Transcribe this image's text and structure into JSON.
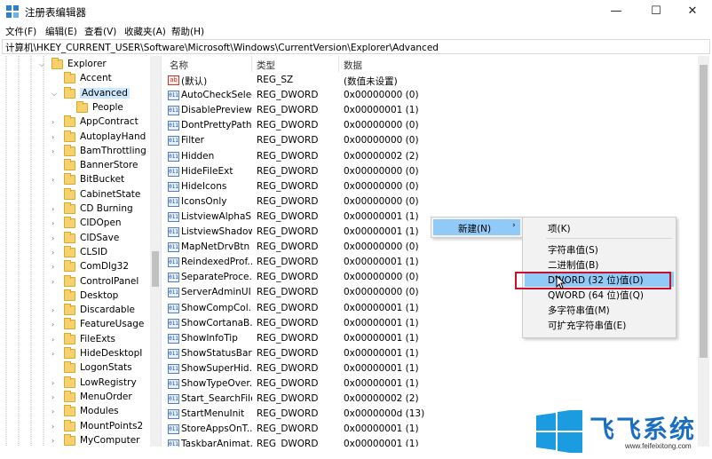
{
  "window": {
    "title": "注册表编辑器",
    "minimize": "—",
    "maximize": "☐",
    "close": "✕"
  },
  "menu": [
    "文件(F)",
    "编辑(E)",
    "查看(V)",
    "收藏夹(A)",
    "帮助(H)"
  ],
  "address": "计算机\\HKEY_CURRENT_USER\\Software\\Microsoft\\Windows\\CurrentVersion\\Explorer\\Advanced",
  "tree": [
    {
      "label": "Explorer",
      "expander": "⌵",
      "depth": 0
    },
    {
      "label": "Accent",
      "expander": "",
      "depth": 1
    },
    {
      "label": "Advanced",
      "expander": "⌵",
      "depth": 1,
      "selected": true
    },
    {
      "label": "People",
      "expander": "",
      "depth": 2
    },
    {
      "label": "AppContract",
      "expander": "›",
      "depth": 1
    },
    {
      "label": "AutoplayHand",
      "expander": "›",
      "depth": 1
    },
    {
      "label": "BamThrottling",
      "expander": "›",
      "depth": 1
    },
    {
      "label": "BannerStore",
      "expander": "",
      "depth": 1
    },
    {
      "label": "BitBucket",
      "expander": "›",
      "depth": 1
    },
    {
      "label": "CabinetState",
      "expander": "",
      "depth": 1
    },
    {
      "label": "CD Burning",
      "expander": "›",
      "depth": 1
    },
    {
      "label": "CIDOpen",
      "expander": "›",
      "depth": 1
    },
    {
      "label": "CIDSave",
      "expander": "›",
      "depth": 1
    },
    {
      "label": "CLSID",
      "expander": "›",
      "depth": 1
    },
    {
      "label": "ComDlg32",
      "expander": "›",
      "depth": 1
    },
    {
      "label": "ControlPanel",
      "expander": "›",
      "depth": 1
    },
    {
      "label": "Desktop",
      "expander": "",
      "depth": 1
    },
    {
      "label": "Discardable",
      "expander": "›",
      "depth": 1
    },
    {
      "label": "FeatureUsage",
      "expander": "›",
      "depth": 1
    },
    {
      "label": "FileExts",
      "expander": "›",
      "depth": 1
    },
    {
      "label": "HideDesktopI",
      "expander": "›",
      "depth": 1
    },
    {
      "label": "LogonStats",
      "expander": "",
      "depth": 1
    },
    {
      "label": "LowRegistry",
      "expander": "›",
      "depth": 1
    },
    {
      "label": "MenuOrder",
      "expander": "›",
      "depth": 1
    },
    {
      "label": "Modules",
      "expander": "›",
      "depth": 1
    },
    {
      "label": "MountPoints2",
      "expander": "›",
      "depth": 1
    },
    {
      "label": "MyComputer",
      "expander": "›",
      "depth": 1
    }
  ],
  "columns": {
    "name": "名称",
    "type": "类型",
    "data": "数据"
  },
  "values": [
    {
      "icon": "ab",
      "name": "(默认)",
      "type": "REG_SZ",
      "data": "(数值未设置)"
    },
    {
      "icon": "011",
      "name": "AutoCheckSelect",
      "type": "REG_DWORD",
      "data": "0x00000000 (0)"
    },
    {
      "icon": "011",
      "name": "DisablePreview...",
      "type": "REG_DWORD",
      "data": "0x00000001 (1)"
    },
    {
      "icon": "011",
      "name": "DontPrettyPath",
      "type": "REG_DWORD",
      "data": "0x00000000 (0)"
    },
    {
      "icon": "011",
      "name": "Filter",
      "type": "REG_DWORD",
      "data": "0x00000000 (0)"
    },
    {
      "icon": "011",
      "name": "Hidden",
      "type": "REG_DWORD",
      "data": "0x00000002 (2)"
    },
    {
      "icon": "011",
      "name": "HideFileExt",
      "type": "REG_DWORD",
      "data": "0x00000000 (0)"
    },
    {
      "icon": "011",
      "name": "HideIcons",
      "type": "REG_DWORD",
      "data": "0x00000000 (0)"
    },
    {
      "icon": "011",
      "name": "IconsOnly",
      "type": "REG_DWORD",
      "data": "0x00000000 (0)"
    },
    {
      "icon": "011",
      "name": "ListviewAlphaS...",
      "type": "REG_DWORD",
      "data": "0x00000001 (1)"
    },
    {
      "icon": "011",
      "name": "ListviewShadow",
      "type": "REG_DWORD",
      "data": "0x00000001 (1)"
    },
    {
      "icon": "011",
      "name": "MapNetDrvBtn",
      "type": "REG_DWORD",
      "data": "0x00000000 (0)"
    },
    {
      "icon": "011",
      "name": "ReindexedProf...",
      "type": "REG_DWORD",
      "data": "0x00000001 (1)"
    },
    {
      "icon": "011",
      "name": "SeparateProce...",
      "type": "REG_DWORD",
      "data": "0x00000000 (0)"
    },
    {
      "icon": "011",
      "name": "ServerAdminUI",
      "type": "REG_DWORD",
      "data": "0x00000000 (0)"
    },
    {
      "icon": "011",
      "name": "ShowCompCol...",
      "type": "REG_DWORD",
      "data": "0x00000001 (1)"
    },
    {
      "icon": "011",
      "name": "ShowCortanaB...",
      "type": "REG_DWORD",
      "data": "0x00000001 (1)"
    },
    {
      "icon": "011",
      "name": "ShowInfoTip",
      "type": "REG_DWORD",
      "data": "0x00000001 (1)"
    },
    {
      "icon": "011",
      "name": "ShowStatusBar",
      "type": "REG_DWORD",
      "data": "0x00000001 (1)"
    },
    {
      "icon": "011",
      "name": "ShowSuperHid...",
      "type": "REG_DWORD",
      "data": "0x00000001 (1)"
    },
    {
      "icon": "011",
      "name": "ShowTypeOver...",
      "type": "REG_DWORD",
      "data": "0x00000001 (1)"
    },
    {
      "icon": "011",
      "name": "Start_SearchFiles",
      "type": "REG_DWORD",
      "data": "0x00000002 (2)"
    },
    {
      "icon": "011",
      "name": "StartMenuInit",
      "type": "REG_DWORD",
      "data": "0x0000000d (13)"
    },
    {
      "icon": "011",
      "name": "StoreAppsOnT...",
      "type": "REG_DWORD",
      "data": "0x00000001 (1)"
    },
    {
      "icon": "011",
      "name": "TaskbarAnimat...",
      "type": "REG_DWORD",
      "data": "0x00000001 (1)"
    }
  ],
  "context_menu": {
    "label": "新建(N)",
    "arrow": "›"
  },
  "submenu": [
    {
      "label": "项(K)"
    },
    {
      "label": "字符串值(S)"
    },
    {
      "label": "二进制值(B)"
    },
    {
      "label": "DWORD (32 位)值(D)",
      "highlighted": true
    },
    {
      "label": "QWORD (64 位)值(Q)"
    },
    {
      "label": "多字符串值(M)"
    },
    {
      "label": "可扩充字符串值(E)"
    }
  ],
  "watermark": {
    "text": "飞飞系统",
    "url": "www.feifeixitong.com"
  },
  "colors": {
    "selection": "#cce8ff",
    "menu_highlight": "#91c9f7",
    "annotation_box": "#c8102e",
    "watermark": "#1b6fc3"
  }
}
